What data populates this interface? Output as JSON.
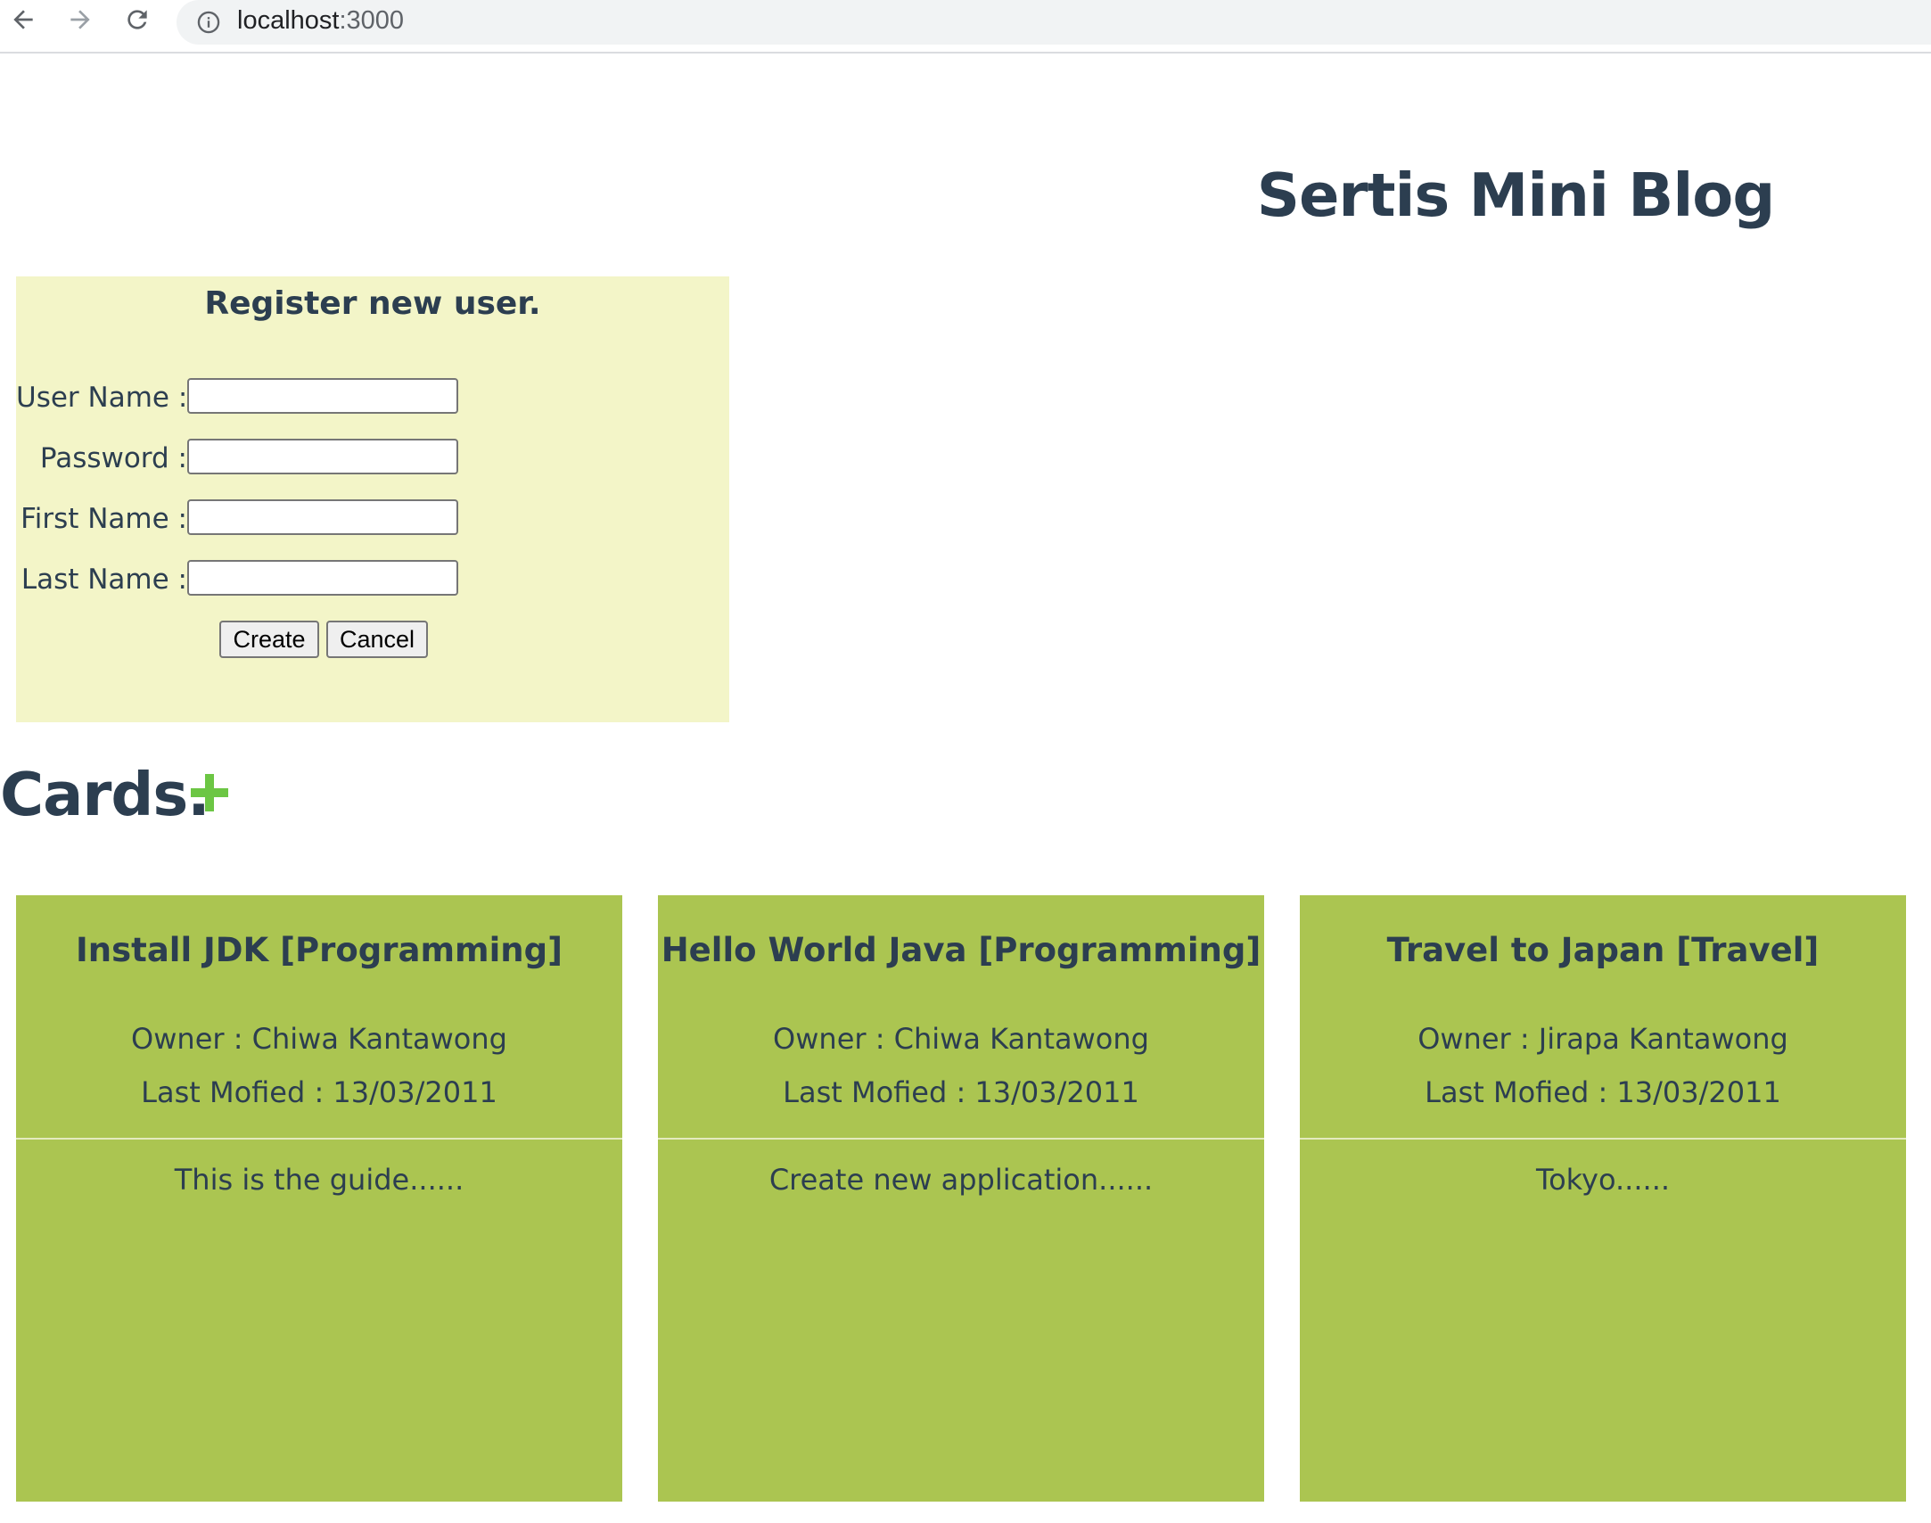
{
  "browser": {
    "url_host": "localhost",
    "url_port": ":3000"
  },
  "page": {
    "title": "Sertis Mini Blog"
  },
  "register": {
    "title": "Register new user.",
    "fields": [
      {
        "label": "User Name :",
        "value": ""
      },
      {
        "label": "Password :",
        "value": ""
      },
      {
        "label": "First Name :",
        "value": ""
      },
      {
        "label": "Last Name :",
        "value": ""
      }
    ],
    "create_label": "Create",
    "cancel_label": "Cancel"
  },
  "cards_section": {
    "heading": "Cards.",
    "add_icon": "plus-icon",
    "accent_color": "#6cc644"
  },
  "cards": [
    {
      "title": "Install JDK [Programming]",
      "owner": "Owner : Chiwa Kantawong",
      "modified": "Last Mofied : 13/03/2011",
      "body": "This is the guide......"
    },
    {
      "title": "Hello World Java [Programming]",
      "owner": "Owner : Chiwa Kantawong",
      "modified": "Last Mofied : 13/03/2011",
      "body": "Create new application......"
    },
    {
      "title": "Travel to Japan [Travel]",
      "owner": "Owner : Jirapa Kantawong",
      "modified": "Last Mofied : 13/03/2011",
      "body": "Tokyo......"
    }
  ],
  "colors": {
    "text": "#2c3e50",
    "register_bg": "#f3f5c8",
    "card_bg": "#abc551"
  }
}
